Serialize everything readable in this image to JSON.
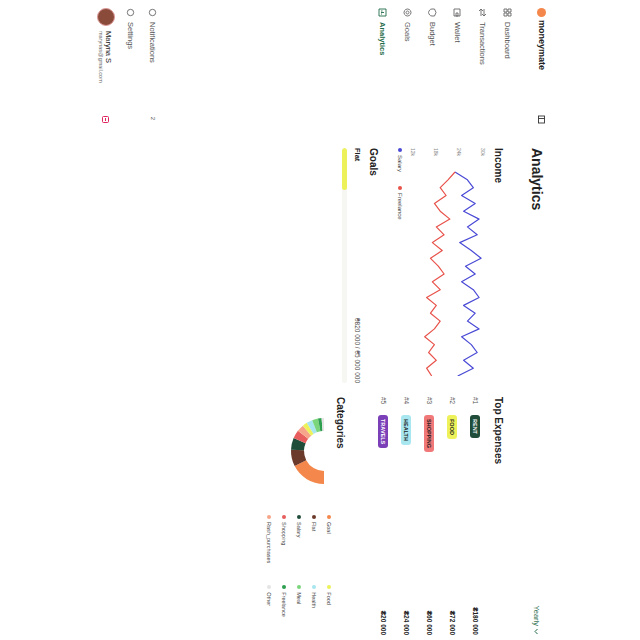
{
  "app": {
    "logo": "moneymate"
  },
  "sidebar": {
    "items": [
      {
        "label": "Dashboard",
        "selected": false
      },
      {
        "label": "Transactions",
        "selected": false
      },
      {
        "label": "Wallet",
        "selected": false
      },
      {
        "label": "Budget",
        "selected": false
      },
      {
        "label": "Goals",
        "selected": false
      },
      {
        "label": "Analytics",
        "selected": true
      }
    ],
    "bottom": [
      {
        "label": "Notifications",
        "badge": "2"
      },
      {
        "label": "Settings",
        "badge": ""
      }
    ],
    "user": {
      "name": "Maryna S",
      "email": "marynas@gmail.com"
    }
  },
  "header": {
    "title": "Analytics",
    "period": "Yearly"
  },
  "income": {
    "title": "Income",
    "ticks": [
      "30k",
      "24k",
      "18k",
      "12k"
    ],
    "series": [
      {
        "name": "Salary",
        "color": "#4a4ad6",
        "values": [
          22.8,
          26,
          27.5,
          24.5,
          28,
          25,
          29,
          26,
          28.5,
          24,
          27,
          29.5,
          25.5,
          28,
          24.5,
          27.5,
          29,
          25,
          28,
          26,
          29,
          24.5,
          27,
          28.5,
          25,
          27.5,
          23.5
        ]
      },
      {
        "name": "Freelance",
        "color": "#e8524a",
        "values": [
          22.8,
          21,
          19,
          20.5,
          17.5,
          19,
          21.5,
          18,
          20,
          17,
          19.5,
          16.5,
          18.5,
          20,
          17,
          19,
          15.5,
          18,
          16.5,
          19,
          17.5,
          15,
          17.5,
          16,
          18,
          15.5,
          16.8
        ]
      }
    ]
  },
  "goals": {
    "title": "Goals",
    "items": [
      {
        "name": "Flat",
        "amount": "₴820 000 / ₴5 000 000",
        "level": 0.18,
        "color": "#eef25a"
      }
    ]
  },
  "top_expenses": {
    "title": "Top Expenses",
    "items": [
      {
        "rank": "#1",
        "label": "RENT",
        "amount": "₴180 000",
        "color": "#1f4d3a"
      },
      {
        "rank": "#2",
        "label": "FOOD",
        "amount": "₴72 000",
        "color": "#eef25a"
      },
      {
        "rank": "#3",
        "label": "SHOPPING",
        "amount": "₴60 000",
        "color": "#f07878"
      },
      {
        "rank": "#4",
        "label": "HEALTH",
        "amount": "₴24 000",
        "color": "#a8e6f0"
      },
      {
        "rank": "#5",
        "label": "TRAVELS",
        "amount": "₴20 000",
        "color": "#7b3fb8"
      }
    ]
  },
  "categories": {
    "title": "Categories",
    "items": [
      {
        "name": "Goal",
        "value": 30,
        "color": "#f4874b"
      },
      {
        "name": "Flat",
        "value": 14,
        "color": "#6b3a2a"
      },
      {
        "name": "Salary",
        "value": 10,
        "color": "#1f4d3a"
      },
      {
        "name": "Shopping",
        "value": 7,
        "color": "#e85d5d"
      },
      {
        "name": "Rash_purchases",
        "value": 6,
        "color": "#f7a58a"
      },
      {
        "name": "Food",
        "value": 4,
        "color": "#eef25a"
      },
      {
        "name": "Health",
        "value": 5,
        "color": "#a8e6f0"
      },
      {
        "name": "Meal",
        "value": 5,
        "color": "#7bd67b"
      },
      {
        "name": "Freelance",
        "value": 3,
        "color": "#2e9e4f"
      },
      {
        "name": "Other",
        "value": 2,
        "color": "#e4e4e4"
      }
    ]
  }
}
